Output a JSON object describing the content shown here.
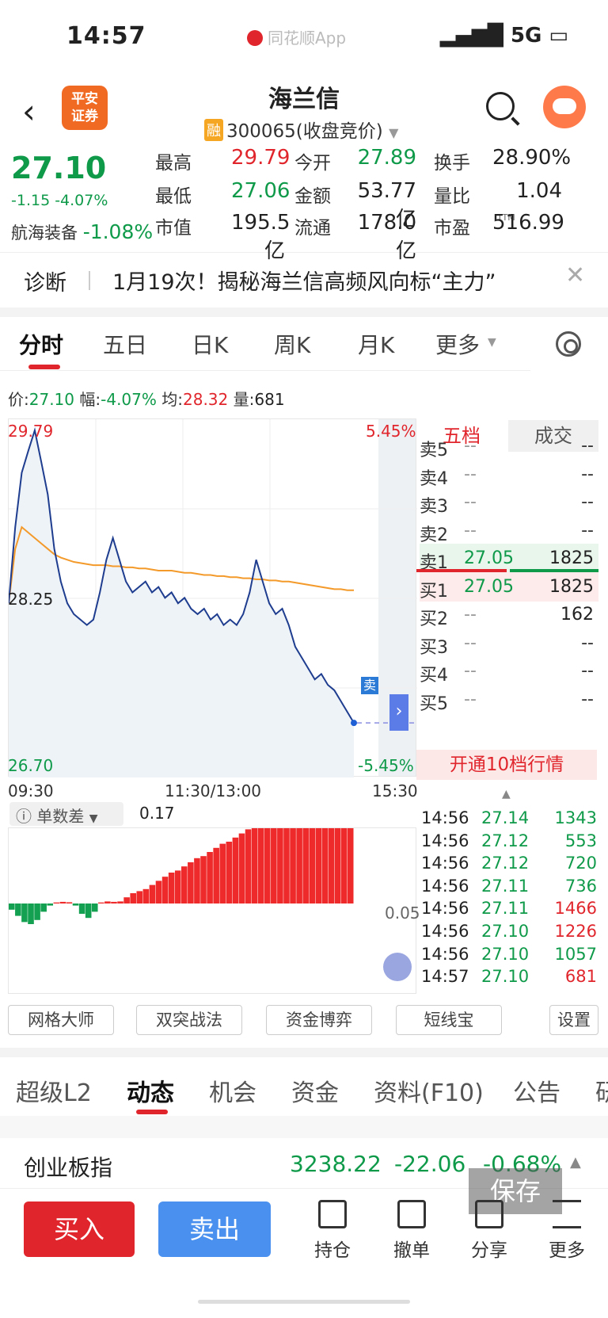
{
  "status": {
    "time": "14:57",
    "app": "同花顺App",
    "network": "5G"
  },
  "header": {
    "broker_logo": "平安\n证券",
    "name": "海兰信",
    "rong": "融",
    "code_line": "300065(收盘竞价)"
  },
  "quote": {
    "price": "27.10",
    "change": "-1.15 -4.07%",
    "sector_name": "航海装备",
    "sector_change": "-1.08%",
    "cells": [
      {
        "label": "最高",
        "value": "29.79",
        "color": "#e0262c"
      },
      {
        "label": "今开",
        "value": "27.89",
        "color": "#0f9a4a"
      },
      {
        "label": "换手",
        "value": "28.90%",
        "color": "#222222"
      },
      {
        "label": "最低",
        "value": "27.06",
        "color": "#0f9a4a"
      },
      {
        "label": "金额",
        "value": "53.77亿",
        "color": "#222222"
      },
      {
        "label": "量比",
        "value": "1.04",
        "color": "#222222"
      },
      {
        "label": "市值",
        "value": "195.5亿",
        "color": "#222222"
      },
      {
        "label": "流通",
        "value": "178.0亿",
        "color": "#222222"
      },
      {
        "label": "市盈",
        "value": "516.99",
        "color": "#222222"
      }
    ],
    "ttm": "TTM"
  },
  "diag": {
    "label": "诊断",
    "text": "1月19次！揭秘海兰信高频风向标“主力”"
  },
  "tabs": [
    "分时",
    "五日",
    "日K",
    "周K",
    "月K",
    "更多"
  ],
  "info_line": {
    "price_label": "价:",
    "price": "27.10",
    "amp_label": "幅:",
    "amp": "-4.07%",
    "avg_label": "均:",
    "avg": "28.32",
    "vol_label": "量:",
    "vol": "681"
  },
  "chart": {
    "y_high": "29.79",
    "y_mid": "28.25",
    "y_low": "26.70",
    "pct_high": "5.45%",
    "pct_low": "-5.45%",
    "t_start": "09:30",
    "t_mid": "11:30/13:00",
    "t_end": "15:30",
    "sell_flag": "卖",
    "arrow": "›",
    "indicator_name": "单数差",
    "indicator_value": "0.17",
    "indicator_axis": "0.05"
  },
  "chart_data": {
    "type": "line",
    "title": "",
    "ylim": [
      26.7,
      29.79
    ],
    "series": [
      {
        "name": "",
        "values": [
          28.2,
          28.9,
          29.4,
          29.6,
          29.79,
          29.5,
          29.2,
          28.7,
          28.4,
          28.2,
          28.1,
          28.05,
          28.0,
          28.05,
          28.3,
          28.6,
          28.8,
          28.6,
          28.4,
          28.3,
          28.35,
          28.4,
          28.3,
          28.35,
          28.25,
          28.3,
          28.2,
          28.25,
          28.15,
          28.1,
          28.15,
          28.05,
          28.1,
          28.0,
          28.05,
          28.0,
          28.1,
          28.3,
          28.6,
          28.4,
          28.2,
          28.1,
          28.15,
          28.0,
          27.8,
          27.7,
          27.6,
          27.5,
          27.55,
          27.45,
          27.4,
          27.3,
          27.2,
          27.1
        ]
      },
      {
        "name": "",
        "values": [
          28.2,
          28.7,
          28.9,
          28.85,
          28.8,
          28.75,
          28.7,
          28.65,
          28.62,
          28.6,
          28.58,
          28.57,
          28.56,
          28.55,
          28.55,
          28.55,
          28.54,
          28.54,
          28.53,
          28.53,
          28.52,
          28.52,
          28.51,
          28.5,
          28.5,
          28.5,
          28.49,
          28.48,
          28.48,
          28.47,
          28.46,
          28.46,
          28.45,
          28.45,
          28.44,
          28.44,
          28.43,
          28.43,
          28.42,
          28.42,
          28.41,
          28.41,
          28.4,
          28.4,
          28.39,
          28.38,
          28.37,
          28.36,
          28.35,
          28.34,
          28.33,
          28.33,
          28.32,
          28.32
        ]
      }
    ],
    "indicator_values": [
      -0.3,
      -0.6,
      -0.9,
      -1.0,
      -0.8,
      -0.4,
      -0.1,
      0.05,
      0.08,
      0.06,
      -0.1,
      -0.5,
      -0.7,
      -0.4,
      0.05,
      0.1,
      0.08,
      0.1,
      0.3,
      0.5,
      0.6,
      0.7,
      0.9,
      1.1,
      1.3,
      1.5,
      1.6,
      1.8,
      2.0,
      2.2,
      2.3,
      2.5,
      2.7,
      2.9,
      3.0,
      3.2,
      3.4,
      3.6,
      3.8,
      4.0,
      4.1,
      4.2,
      4.3,
      4.4,
      4.4,
      4.5,
      4.5,
      4.6,
      4.6,
      4.7,
      4.7,
      4.8,
      4.8,
      4.9
    ]
  },
  "orderbook": {
    "tab_active": "五档",
    "tab_other": "成交",
    "rows": [
      {
        "k": "卖5",
        "p": "--",
        "v": "--"
      },
      {
        "k": "卖4",
        "p": "--",
        "v": "--"
      },
      {
        "k": "卖3",
        "p": "--",
        "v": "--"
      },
      {
        "k": "卖2",
        "p": "--",
        "v": "--"
      },
      {
        "k": "卖1",
        "p": "27.05",
        "v": "1825"
      },
      {
        "k": "买1",
        "p": "27.05",
        "v": "1825"
      },
      {
        "k": "买2",
        "p": "--",
        "v": "162"
      },
      {
        "k": "买3",
        "p": "--",
        "v": "--"
      },
      {
        "k": "买4",
        "p": "--",
        "v": "--"
      },
      {
        "k": "买5",
        "p": "--",
        "v": "--"
      }
    ],
    "open10": "开通10档行情",
    "ticks": [
      {
        "t": "14:56",
        "p": "27.14",
        "v": "1343",
        "vc": "#0f9a4a"
      },
      {
        "t": "14:56",
        "p": "27.12",
        "v": "553",
        "vc": "#0f9a4a"
      },
      {
        "t": "14:56",
        "p": "27.12",
        "v": "720",
        "vc": "#0f9a4a"
      },
      {
        "t": "14:56",
        "p": "27.11",
        "v": "736",
        "vc": "#0f9a4a"
      },
      {
        "t": "14:56",
        "p": "27.11",
        "v": "1466",
        "vc": "#e0262c"
      },
      {
        "t": "14:56",
        "p": "27.10",
        "v": "1226",
        "vc": "#e0262c"
      },
      {
        "t": "14:56",
        "p": "27.10",
        "v": "1057",
        "vc": "#0f9a4a"
      },
      {
        "t": "14:57",
        "p": "27.10",
        "v": "681",
        "vc": "#e0262c"
      }
    ]
  },
  "tools": [
    "网格大师",
    "双突战法",
    "资金博弈",
    "短线宝",
    "设置"
  ],
  "tabs2": [
    "超级L2",
    "动态",
    "机会",
    "资金",
    "资料(F10)",
    "公告",
    "研"
  ],
  "index": {
    "name": "创业板指",
    "value": "3238.22",
    "change": "-22.06",
    "pct": "-0.68%"
  },
  "save_overlay": "保存",
  "bottom": {
    "buy": "买入",
    "sell": "卖出",
    "items": [
      "持仓",
      "撤单",
      "分享",
      "更多"
    ]
  }
}
